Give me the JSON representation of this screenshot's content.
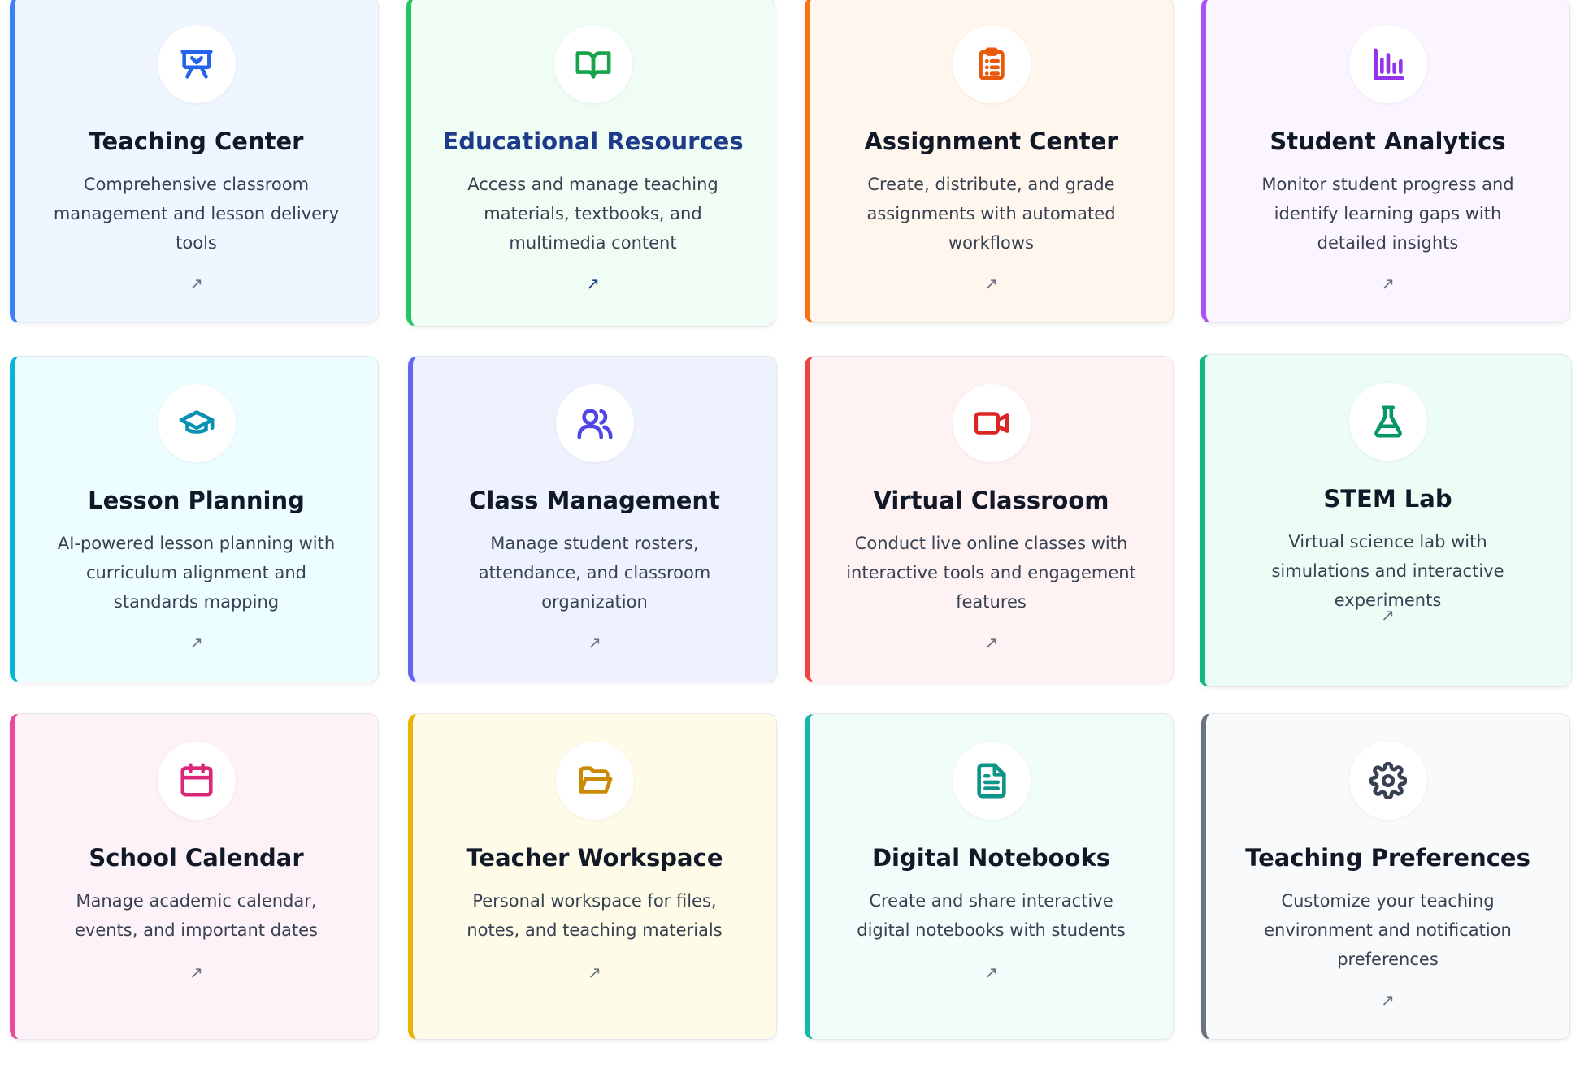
{
  "cards": [
    {
      "title": "Teaching Center",
      "description": "Comprehensive classroom management and lesson delivery tools",
      "arrow": "↗",
      "icon": "presentation-icon",
      "accent": "#3b82f6",
      "background": "#eff6ff",
      "icon_color": "#2563eb"
    },
    {
      "title": "Educational Resources",
      "description": "Access and manage teaching materials, textbooks, and multimedia content",
      "arrow": "↗",
      "icon": "book-open-icon",
      "accent": "#22c55e",
      "background": "#f0fdf4",
      "icon_color": "#16a34a"
    },
    {
      "title": "Assignment Center",
      "description": "Create, distribute, and grade assignments with automated workflows",
      "arrow": "↗",
      "icon": "clipboard-list-icon",
      "accent": "#f97316",
      "background": "#fff7ed",
      "icon_color": "#ea580c"
    },
    {
      "title": "Student Analytics",
      "description": "Monitor student progress and identify learning gaps with detailed insights",
      "arrow": "↗",
      "icon": "bar-chart-icon",
      "accent": "#a855f7",
      "background": "#faf5ff",
      "icon_color": "#9333ea"
    },
    {
      "title": "Lesson Planning",
      "description": "AI-powered lesson planning with curriculum alignment and standards mapping",
      "arrow": "↗",
      "icon": "graduation-cap-icon",
      "accent": "#06b6d4",
      "background": "#ecfeff",
      "icon_color": "#0891b2"
    },
    {
      "title": "Class Management",
      "description": "Manage student rosters, attendance, and classroom organization",
      "arrow": "↗",
      "icon": "users-icon",
      "accent": "#6366f1",
      "background": "#eef2ff",
      "icon_color": "#4f46e5"
    },
    {
      "title": "Virtual Classroom",
      "description": "Conduct live online classes with interactive tools and engagement features",
      "arrow": "↗",
      "icon": "video-camera-icon",
      "accent": "#ef4444",
      "background": "#fef2f2",
      "icon_color": "#dc2626"
    },
    {
      "title": "STEM Lab",
      "description": "Virtual science lab with simulations and interactive experiments",
      "arrow": "↗",
      "icon": "flask-icon",
      "accent": "#10b981",
      "background": "#ecfdf5",
      "icon_color": "#059669"
    },
    {
      "title": "School Calendar",
      "description": "Manage academic calendar, events, and important dates",
      "arrow": "↗",
      "icon": "calendar-icon",
      "accent": "#ec4899",
      "background": "#fdf2f8",
      "icon_color": "#db2777"
    },
    {
      "title": "Teacher Workspace",
      "description": "Personal workspace for files, notes, and teaching materials",
      "arrow": "↗",
      "icon": "folder-open-icon",
      "accent": "#eab308",
      "background": "#fefce8",
      "icon_color": "#ca8a04"
    },
    {
      "title": "Digital Notebooks",
      "description": "Create and share interactive digital notebooks with students",
      "arrow": "↗",
      "icon": "document-text-icon",
      "accent": "#14b8a6",
      "background": "#f0fdfa",
      "icon_color": "#0d9488"
    },
    {
      "title": "Teaching Preferences",
      "description": "Customize your teaching environment and notification preferences",
      "arrow": "↗",
      "icon": "gear-icon",
      "accent": "#6b7280",
      "background": "#f9fafb",
      "icon_color": "#374151"
    }
  ]
}
